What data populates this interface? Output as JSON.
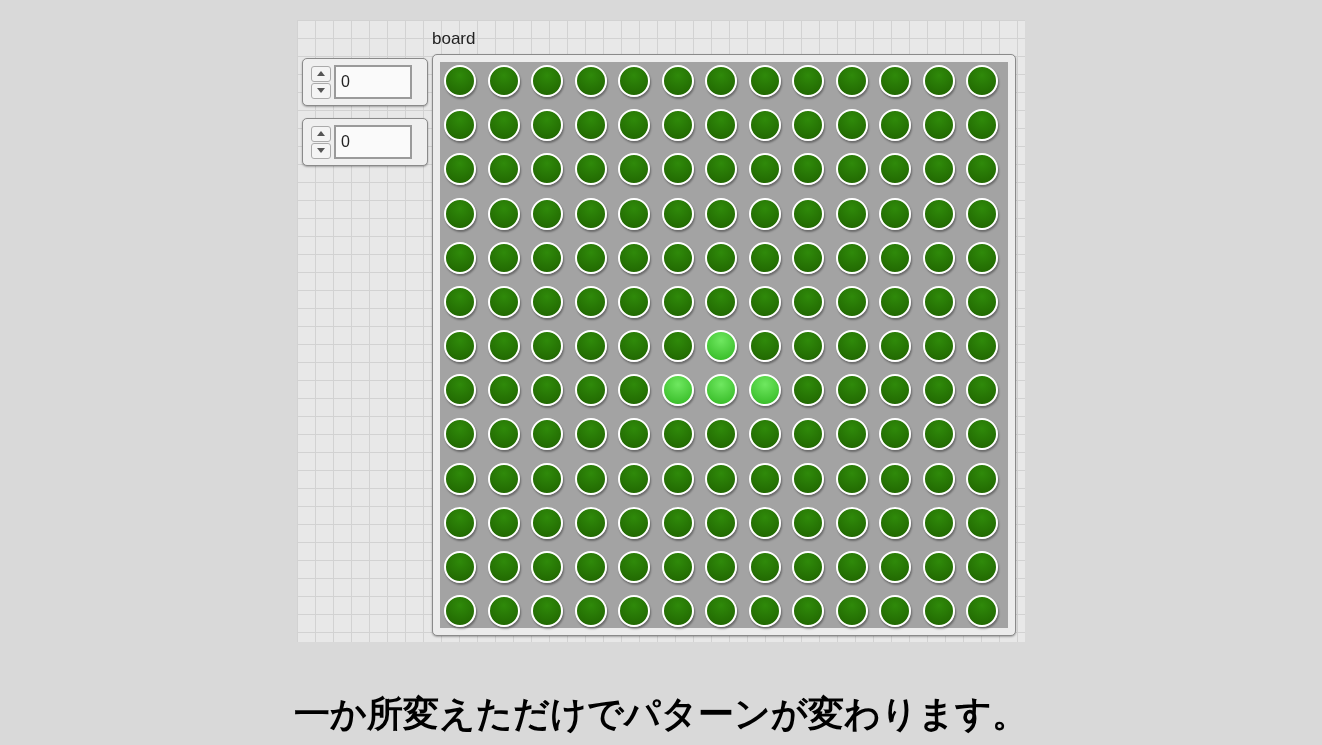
{
  "numeric_controls": [
    {
      "value": "0"
    },
    {
      "value": "0"
    }
  ],
  "board": {
    "label": "board",
    "rows": [
      [
        {
          "on": false
        },
        {
          "on": false
        },
        {
          "on": false
        },
        {
          "on": false
        },
        {
          "on": false
        },
        {
          "on": false
        },
        {
          "on": false
        },
        {
          "on": false
        },
        {
          "on": false
        },
        {
          "on": false
        },
        {
          "on": false
        },
        {
          "on": false
        },
        {
          "on": false
        }
      ],
      [
        {
          "on": false
        },
        {
          "on": false
        },
        {
          "on": false
        },
        {
          "on": false
        },
        {
          "on": false
        },
        {
          "on": false
        },
        {
          "on": false
        },
        {
          "on": false
        },
        {
          "on": false
        },
        {
          "on": false
        },
        {
          "on": false
        },
        {
          "on": false
        },
        {
          "on": false
        }
      ],
      [
        {
          "on": false
        },
        {
          "on": false
        },
        {
          "on": false
        },
        {
          "on": false
        },
        {
          "on": false
        },
        {
          "on": false
        },
        {
          "on": false
        },
        {
          "on": false
        },
        {
          "on": false
        },
        {
          "on": false
        },
        {
          "on": false
        },
        {
          "on": false
        },
        {
          "on": false
        }
      ],
      [
        {
          "on": false
        },
        {
          "on": false
        },
        {
          "on": false
        },
        {
          "on": false
        },
        {
          "on": false
        },
        {
          "on": false
        },
        {
          "on": false
        },
        {
          "on": false
        },
        {
          "on": false
        },
        {
          "on": false
        },
        {
          "on": false
        },
        {
          "on": false
        },
        {
          "on": false
        }
      ],
      [
        {
          "on": false
        },
        {
          "on": false
        },
        {
          "on": false
        },
        {
          "on": false
        },
        {
          "on": false
        },
        {
          "on": false
        },
        {
          "on": false
        },
        {
          "on": false
        },
        {
          "on": false
        },
        {
          "on": false
        },
        {
          "on": false
        },
        {
          "on": false
        },
        {
          "on": false
        }
      ],
      [
        {
          "on": false
        },
        {
          "on": false
        },
        {
          "on": false
        },
        {
          "on": false
        },
        {
          "on": false
        },
        {
          "on": false
        },
        {
          "on": false
        },
        {
          "on": false
        },
        {
          "on": false
        },
        {
          "on": false
        },
        {
          "on": false
        },
        {
          "on": false
        },
        {
          "on": false
        }
      ],
      [
        {
          "on": false
        },
        {
          "on": false
        },
        {
          "on": false
        },
        {
          "on": false
        },
        {
          "on": false
        },
        {
          "on": false
        },
        {
          "on": true
        },
        {
          "on": false
        },
        {
          "on": false
        },
        {
          "on": false
        },
        {
          "on": false
        },
        {
          "on": false
        },
        {
          "on": false
        }
      ],
      [
        {
          "on": false
        },
        {
          "on": false
        },
        {
          "on": false
        },
        {
          "on": false
        },
        {
          "on": false
        },
        {
          "on": true
        },
        {
          "on": true
        },
        {
          "on": true
        },
        {
          "on": false
        },
        {
          "on": false
        },
        {
          "on": false
        },
        {
          "on": false
        },
        {
          "on": false
        }
      ],
      [
        {
          "on": false
        },
        {
          "on": false
        },
        {
          "on": false
        },
        {
          "on": false
        },
        {
          "on": false
        },
        {
          "on": false
        },
        {
          "on": false
        },
        {
          "on": false
        },
        {
          "on": false
        },
        {
          "on": false
        },
        {
          "on": false
        },
        {
          "on": false
        },
        {
          "on": false
        }
      ],
      [
        {
          "on": false
        },
        {
          "on": false
        },
        {
          "on": false
        },
        {
          "on": false
        },
        {
          "on": false
        },
        {
          "on": false
        },
        {
          "on": false
        },
        {
          "on": false
        },
        {
          "on": false
        },
        {
          "on": false
        },
        {
          "on": false
        },
        {
          "on": false
        },
        {
          "on": false
        }
      ],
      [
        {
          "on": false
        },
        {
          "on": false
        },
        {
          "on": false
        },
        {
          "on": false
        },
        {
          "on": false
        },
        {
          "on": false
        },
        {
          "on": false
        },
        {
          "on": false
        },
        {
          "on": false
        },
        {
          "on": false
        },
        {
          "on": false
        },
        {
          "on": false
        },
        {
          "on": false
        }
      ],
      [
        {
          "on": false
        },
        {
          "on": false
        },
        {
          "on": false
        },
        {
          "on": false
        },
        {
          "on": false
        },
        {
          "on": false
        },
        {
          "on": false
        },
        {
          "on": false
        },
        {
          "on": false
        },
        {
          "on": false
        },
        {
          "on": false
        },
        {
          "on": false
        },
        {
          "on": false
        }
      ],
      [
        {
          "on": false
        },
        {
          "on": false
        },
        {
          "on": false
        },
        {
          "on": false
        },
        {
          "on": false
        },
        {
          "on": false
        },
        {
          "on": false
        },
        {
          "on": false
        },
        {
          "on": false
        },
        {
          "on": false
        },
        {
          "on": false
        },
        {
          "on": false
        },
        {
          "on": false
        }
      ]
    ]
  },
  "caption": "一か所変えただけでパターンが変わります。"
}
